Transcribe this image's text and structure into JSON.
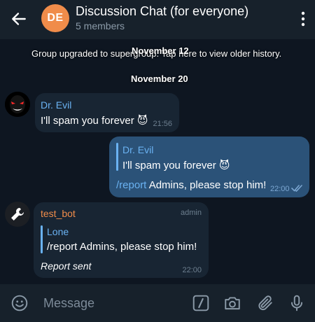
{
  "header": {
    "avatar_initials": "DE",
    "avatar_color": "#f08c4a",
    "title": "Discussion Chat (for everyone)",
    "subtitle": "5 members",
    "back_icon": "arrow-left-icon",
    "menu_icon": "more-vertical-icon"
  },
  "service": {
    "upgrade_text": "Group upgraded to supergroup. Tap here to view older history.",
    "date_1": "November 12",
    "date_2": "November 20"
  },
  "messages": [
    {
      "sender": "Dr. Evil",
      "sender_color": "#6ab2f2",
      "text": "I'll spam you forever 😈",
      "time": "21:56"
    },
    {
      "reply_to_sender": "Dr. Evil",
      "reply_to_text": "I'll spam you forever 😈",
      "command": "/report",
      "text": " Admins, please stop him!",
      "time": "22:00",
      "status_icon": "double-check-icon"
    },
    {
      "sender": "test_bot",
      "sender_color": "#f08c4a",
      "badge": "admin",
      "reply_to_sender": "Lone",
      "reply_to_text": "/report Admins, please stop him!",
      "text": "Report sent",
      "time": "22:00"
    }
  ],
  "input": {
    "placeholder": "Message",
    "icons": [
      "emoji-icon",
      "bot-command-icon",
      "camera-icon",
      "attach-icon",
      "microphone-icon"
    ]
  },
  "colors": {
    "background": "#0e1621",
    "header": "#17212b",
    "incoming_bubble": "#182533",
    "outgoing_bubble": "#2b5278",
    "accent": "#6ab2f2"
  }
}
